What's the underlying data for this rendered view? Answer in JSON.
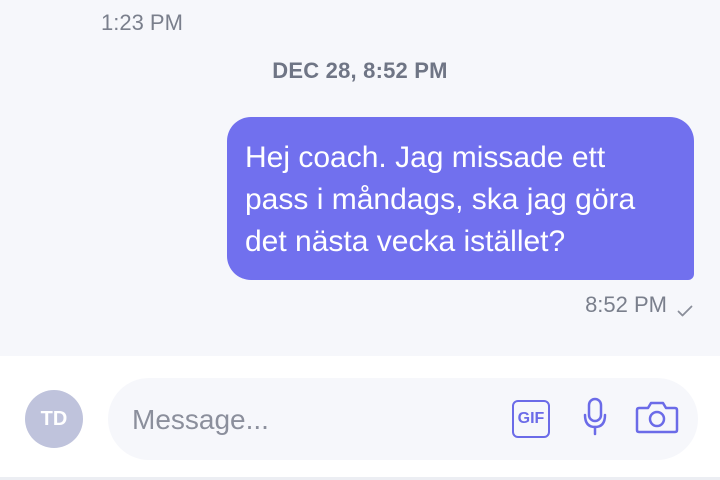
{
  "chat": {
    "previous_time": "1:23 PM",
    "date_divider": "DEC 28, 8:52 PM",
    "message": {
      "lines": [
        "Hej coach. Jag missade ett",
        "pass i måndags, ska jag göra",
        "det nästa vecka istället?"
      ],
      "time": "8:52 PM",
      "status_icon": "check-icon"
    }
  },
  "composer": {
    "avatar_initials": "TD",
    "placeholder": "Message...",
    "value": "",
    "gif_label": "GIF",
    "mic_icon": "microphone-icon",
    "camera_icon": "camera-icon"
  },
  "colors": {
    "bubble": "#7170ee",
    "accent": "#6b6be8",
    "chat_background": "#f6f7fb",
    "avatar": "#bfc3dc"
  }
}
